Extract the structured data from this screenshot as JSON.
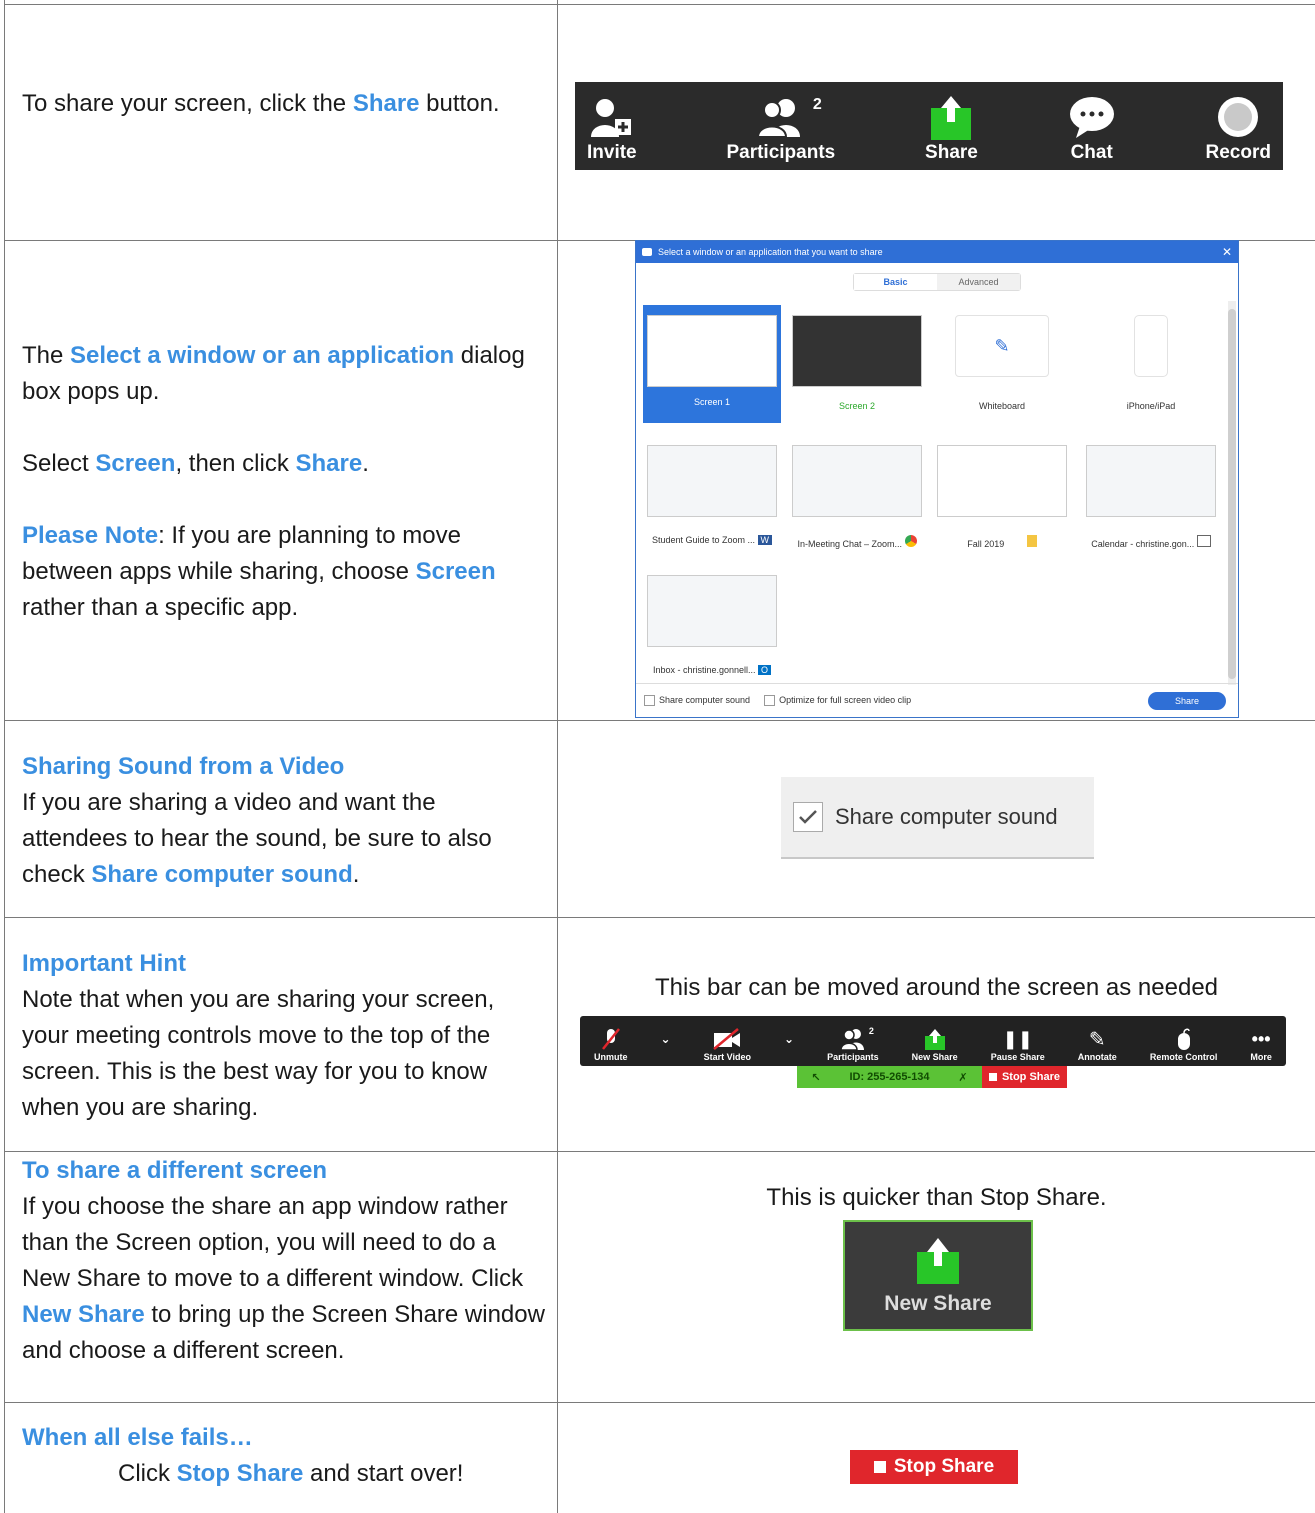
{
  "rows": {
    "r1": {
      "pre": "To share your screen, click the ",
      "hl": "Share",
      "post": " button."
    },
    "r2": {
      "p1_pre": "The ",
      "p1_hl": "Select a window or an application",
      "p1_post": " dialog box pops up.",
      "p2_pre": "Select ",
      "p2_hl1": "Screen",
      "p2_mid": ", then click ",
      "p2_hl2": "Share",
      "p2_post": ".",
      "p3_hl1": "Please Note",
      "p3_mid": ": If you are planning to move between apps while sharing, choose ",
      "p3_hl2": "Screen",
      "p3_post": " rather than a specific app."
    },
    "r3": {
      "heading": "Sharing Sound from a Video",
      "pre": "If you are sharing a video and want the attendees to hear the sound, be sure to also check ",
      "hl": "Share computer sound",
      "post": "."
    },
    "r4": {
      "heading": "Important Hint",
      "body": "Note that when you are sharing your screen, your meeting controls move to the top of the screen. This is the best way for you to know when you are sharing.",
      "caption": "This bar can be moved around the screen as needed"
    },
    "r5": {
      "heading": "To share a different screen",
      "pre": "If you choose the share an app window rather than the Screen option, you will need to do a New Share to move to a different window. Click ",
      "hl": "New Share",
      "post": " to bring up the Screen Share window and choose a different screen.",
      "caption": "This is quicker than Stop Share."
    },
    "r6": {
      "heading": "When all else fails…",
      "pre": "Click ",
      "hl": "Stop Share",
      "post": " and start over!"
    }
  },
  "toolbar": {
    "items": [
      {
        "label": "Invite",
        "icon": "invite-icon"
      },
      {
        "label": "Participants",
        "icon": "participants-icon",
        "badge": "2"
      },
      {
        "label": "Share",
        "icon": "share-icon"
      },
      {
        "label": "Chat",
        "icon": "chat-icon"
      },
      {
        "label": "Record",
        "icon": "record-icon"
      }
    ]
  },
  "dialog": {
    "title": "Select a window or an application that you want to share",
    "tabs": [
      "Basic",
      "Advanced"
    ],
    "tiles": [
      {
        "label": "Screen 1",
        "num": "1"
      },
      {
        "label": "Screen 2",
        "num": "2"
      },
      {
        "label": "Whiteboard"
      },
      {
        "label": "iPhone/iPad"
      },
      {
        "label": "Student Guide to Zoom ..."
      },
      {
        "label": "In-Meeting Chat – Zoom..."
      },
      {
        "label": "Fall 2019"
      },
      {
        "label": "Calendar - christine.gon..."
      },
      {
        "label": "Inbox - christine.gonnell..."
      }
    ],
    "footer": {
      "sound": "Share computer sound",
      "optimize": "Optimize for full screen video clip",
      "share_btn": "Share"
    }
  },
  "sound_checkbox": {
    "label": "Share computer sound",
    "checked": true
  },
  "meeting_bar": {
    "items": [
      "Unmute",
      "Start Video",
      "Participants",
      "New Share",
      "Pause Share",
      "Annotate",
      "Remote Control",
      "More"
    ],
    "participants_badge": "2",
    "meeting_id": "ID: 255-265-134",
    "stop_share": "Stop Share"
  },
  "new_share_button": {
    "label": "New Share"
  },
  "stop_share_button": {
    "label": "Stop Share"
  },
  "colors": {
    "accent": "#3a8fe0",
    "green": "#5bc236",
    "red": "#e0262c",
    "dark": "#2b2b2b"
  }
}
